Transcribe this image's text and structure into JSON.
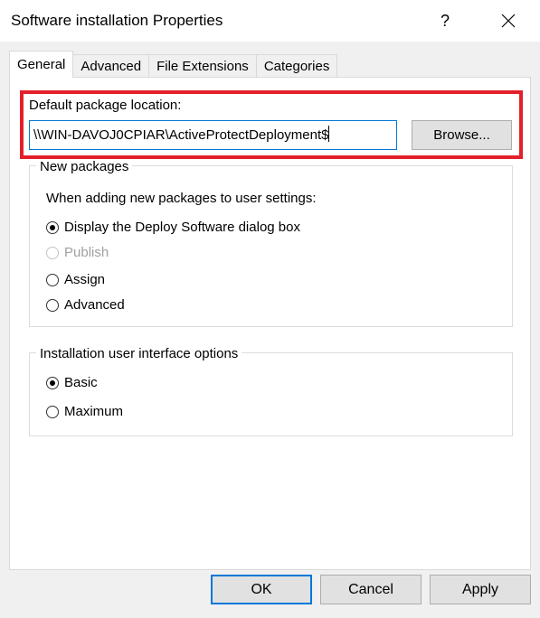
{
  "window": {
    "title": "Software installation Properties",
    "help_glyph": "?"
  },
  "tabs": [
    {
      "label": "General",
      "active": true
    },
    {
      "label": "Advanced",
      "active": false
    },
    {
      "label": "File Extensions",
      "active": false
    },
    {
      "label": "Categories",
      "active": false
    }
  ],
  "package_location": {
    "label": "Default package location:",
    "value": "\\\\WIN-DAVOJ0CPIAR\\ActiveProtectDeployment$",
    "browse_label": "Browse..."
  },
  "new_packages": {
    "title": "New packages",
    "prompt": "When adding new packages to user settings:",
    "options": [
      {
        "label": "Display the Deploy Software dialog box",
        "checked": true,
        "disabled": false
      },
      {
        "label": "Publish",
        "checked": false,
        "disabled": true
      },
      {
        "label": "Assign",
        "checked": false,
        "disabled": false
      },
      {
        "label": "Advanced",
        "checked": false,
        "disabled": false
      }
    ]
  },
  "ui_options": {
    "title": "Installation user interface options",
    "options": [
      {
        "label": "Basic",
        "checked": true
      },
      {
        "label": "Maximum",
        "checked": false
      }
    ]
  },
  "buttons": {
    "ok": "OK",
    "cancel": "Cancel",
    "apply": "Apply"
  },
  "colors": {
    "highlight": "#e3202a",
    "focus": "#0078d7"
  }
}
